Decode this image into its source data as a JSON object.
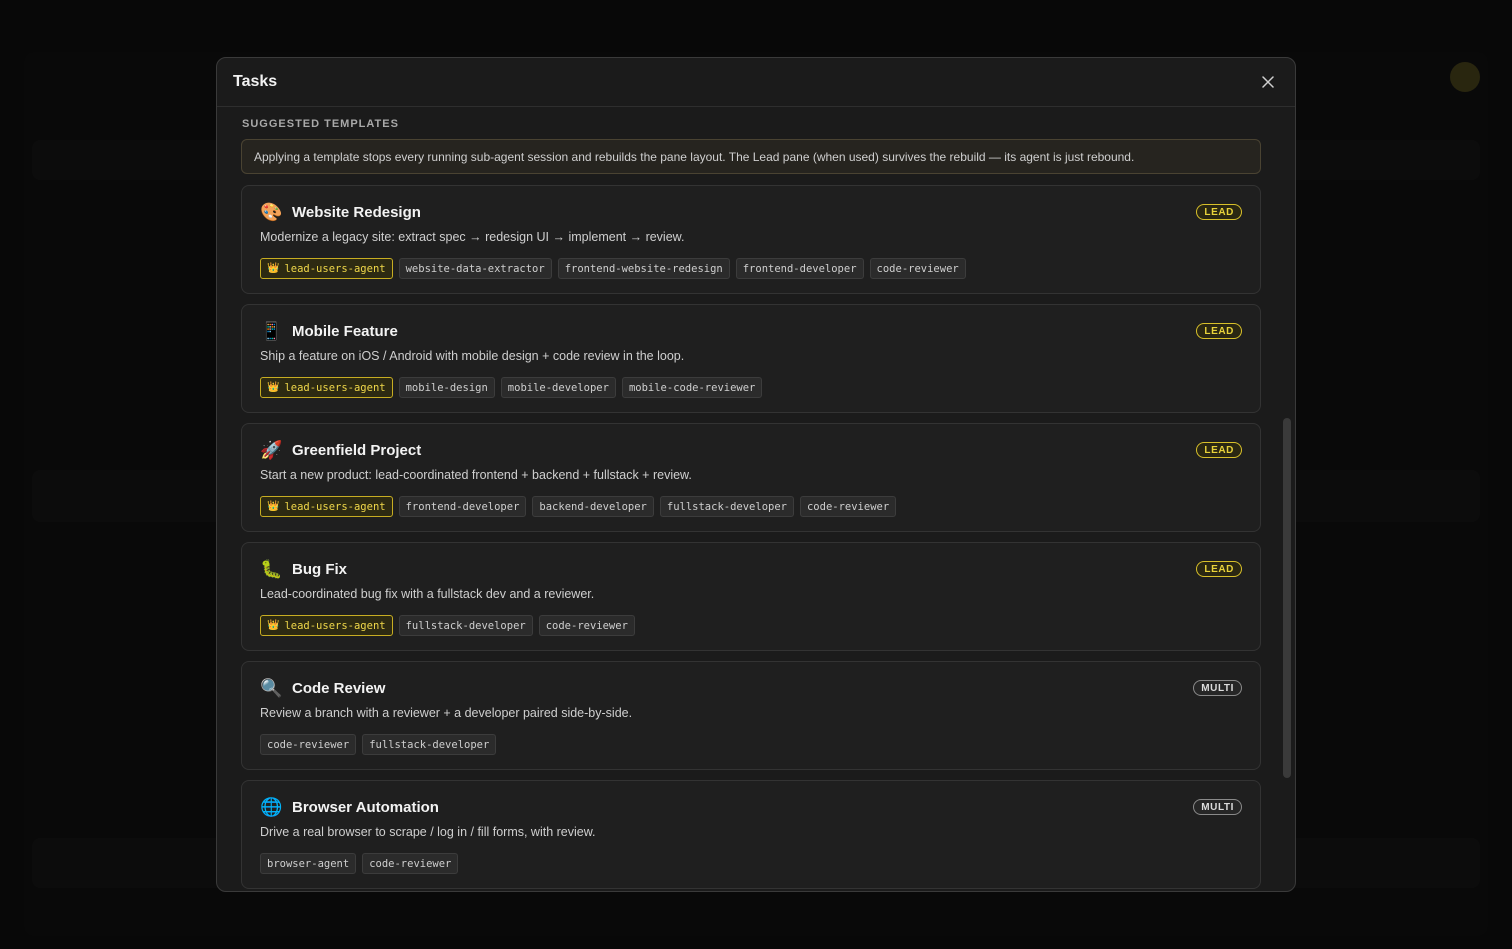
{
  "modal": {
    "title": "Tasks",
    "section_label": "SUGGESTED TEMPLATES",
    "notice": "Applying a template stops every running sub-agent session and rebuilds the pane layout. The Lead pane (when used) survives the rebuild — its agent is just rebound."
  },
  "templates": [
    {
      "emoji": "🎨",
      "title": "Website Redesign",
      "badge": "LEAD",
      "badge_type": "lead",
      "description": "Modernize a legacy site: extract spec → redesign UI → implement → review.",
      "chips": [
        "lead-users-agent",
        "website-data-extractor",
        "frontend-website-redesign",
        "frontend-developer",
        "code-reviewer"
      ]
    },
    {
      "emoji": "📱",
      "title": "Mobile Feature",
      "badge": "LEAD",
      "badge_type": "lead",
      "description": "Ship a feature on iOS / Android with mobile design + code review in the loop.",
      "chips": [
        "lead-users-agent",
        "mobile-design",
        "mobile-developer",
        "mobile-code-reviewer"
      ]
    },
    {
      "emoji": "🚀",
      "title": "Greenfield Project",
      "badge": "LEAD",
      "badge_type": "lead",
      "description": "Start a new product: lead-coordinated frontend + backend + fullstack + review.",
      "chips": [
        "lead-users-agent",
        "frontend-developer",
        "backend-developer",
        "fullstack-developer",
        "code-reviewer"
      ]
    },
    {
      "emoji": "🐛",
      "title": "Bug Fix",
      "badge": "LEAD",
      "badge_type": "lead",
      "description": "Lead-coordinated bug fix with a fullstack dev and a reviewer.",
      "chips": [
        "lead-users-agent",
        "fullstack-developer",
        "code-reviewer"
      ]
    },
    {
      "emoji": "🔍",
      "title": "Code Review",
      "badge": "MULTI",
      "badge_type": "multi",
      "description": "Review a branch with a reviewer + a developer paired side-by-side.",
      "chips": [
        "code-reviewer",
        "fullstack-developer"
      ]
    },
    {
      "emoji": "🌐",
      "title": "Browser Automation",
      "badge": "MULTI",
      "badge_type": "multi",
      "description": "Drive a real browser to scrape / log in / fill forms, with review.",
      "chips": [
        "browser-agent",
        "code-reviewer"
      ]
    }
  ],
  "icons": {
    "close": "close-icon",
    "crown": "crown-icon"
  },
  "colors": {
    "lead_accent": "#e8d23a",
    "modal_bg": "#1b1b1b",
    "card_bg": "#1f1f1f"
  }
}
